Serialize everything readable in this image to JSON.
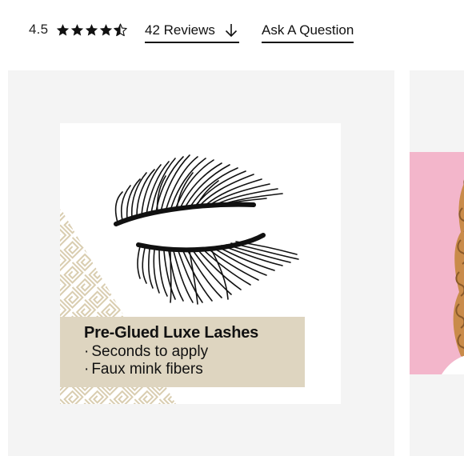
{
  "rating": {
    "value": "4.5",
    "stars_filled": 4.5,
    "stars_total": 5,
    "star_color": "#111111"
  },
  "reviews": {
    "label": "42 Reviews",
    "icon": "arrow-down-icon"
  },
  "question": {
    "label": "Ask A Question"
  },
  "product": {
    "promo_title": "Pre-Glued Luxe Lashes",
    "bullets": [
      "Seconds to apply",
      "Faux mink fibers"
    ],
    "promo_bg": "#ded5c0",
    "pattern_color": "#d9cdb0"
  },
  "side": {
    "bg": "#f3b6cb"
  }
}
